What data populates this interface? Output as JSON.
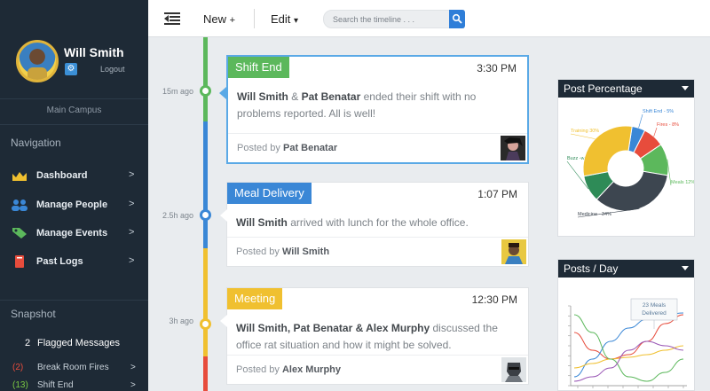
{
  "profile": {
    "name": "Will Smith",
    "logout": "Logout",
    "gear": "⚙",
    "campus": "Main Campus"
  },
  "nav": {
    "title": "Navigation",
    "items": [
      {
        "label": "Dashboard",
        "icon": "dashboard-icon",
        "arrow": ">"
      },
      {
        "label": "Manage People",
        "icon": "people-icon",
        "arrow": ">"
      },
      {
        "label": "Manage Events",
        "icon": "tag-icon",
        "arrow": ">"
      },
      {
        "label": "Past Logs",
        "icon": "book-icon",
        "arrow": ">"
      }
    ]
  },
  "snapshot": {
    "title": "Snapshot",
    "flagged_count": "2",
    "flagged_label": "Flagged Messages",
    "items": [
      {
        "count": "(2)",
        "label": "Break Room Fires",
        "color": "#e74c3c",
        "arrow": ">"
      },
      {
        "count": "(13)",
        "label": "Shift End",
        "color": "#7ac943",
        "arrow": ">"
      }
    ]
  },
  "toolbar": {
    "new_label": "New",
    "new_plus": "+",
    "edit_label": "Edit",
    "edit_caret": "▾",
    "search_placeholder": "Search the timeline . . ."
  },
  "timeline": [
    {
      "ago": "15m ago",
      "tag": "Shift End",
      "tag_color": "#5cb85c",
      "time": "3:30 PM",
      "body_parts": [
        "Will Smith",
        " & ",
        "Pat Benatar",
        " ended their shift with no problems reported. All is well!"
      ],
      "posted_prefix": "Posted by",
      "posted_by": "Pat Benatar",
      "active": true
    },
    {
      "ago": "2.5h ago",
      "tag": "Meal Delivery",
      "tag_color": "#3a87d6",
      "time": "1:07 PM",
      "body_parts": [
        "Will Smith",
        " arrived with lunch for the whole office."
      ],
      "posted_prefix": "Posted by",
      "posted_by": "Will Smith",
      "active": false
    },
    {
      "ago": "3h ago",
      "tag": "Meeting",
      "tag_color": "#f0c030",
      "time": "12:30 PM",
      "body_parts": [
        "Will Smith, Pat Benatar & Alex Murphy",
        " discussed the office rat situation and how it might be solved."
      ],
      "posted_prefix": "Posted by",
      "posted_by": "Alex Murphy",
      "active": false
    }
  ],
  "widgets": {
    "post_percentage": {
      "title": "Post Percentage",
      "chart_data": {
        "type": "pie",
        "slices": [
          {
            "label": "Shift End - 5%",
            "value": 5,
            "color": "#3a87d6"
          },
          {
            "label": "Fires - 8%",
            "value": 8,
            "color": "#e74c3c"
          },
          {
            "label": "Meals 12%",
            "value": 12,
            "color": "#5cb85c"
          },
          {
            "label": "Medicine - 34%",
            "value": 34,
            "color": "#3d4650"
          },
          {
            "label": "Buzz -words 10%",
            "value": 10,
            "color": "#2e8b57"
          },
          {
            "label": "Training 30%",
            "value": 30,
            "color": "#f0c030"
          }
        ]
      }
    },
    "posts_day": {
      "title": "Posts / Day",
      "annotation": "23 Meals Delivered",
      "chart_data": {
        "type": "line",
        "series": [
          {
            "color": "#e74c3c",
            "values": [
              6,
              4,
              3,
              3.5,
              5,
              7,
              8
            ]
          },
          {
            "color": "#3a87d6",
            "values": [
              1,
              3,
              5,
              6.5,
              7.5,
              8,
              8.2
            ]
          },
          {
            "color": "#f0c030",
            "values": [
              2,
              2.5,
              3,
              3.2,
              3.5,
              4,
              4.5
            ]
          },
          {
            "color": "#5cb85c",
            "values": [
              8,
              6,
              3,
              1,
              0.5,
              1.5,
              3
            ]
          },
          {
            "color": "#9b59b6",
            "values": [
              0.5,
              1,
              2,
              4,
              5,
              4.5,
              4
            ]
          }
        ]
      }
    }
  }
}
